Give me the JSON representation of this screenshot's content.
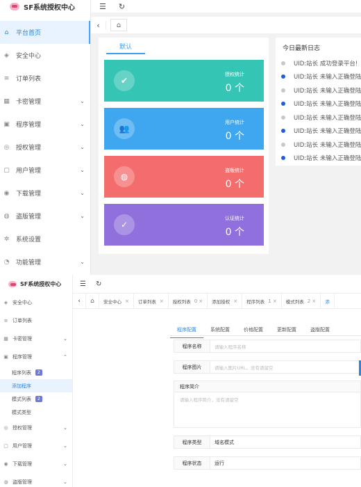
{
  "top": {
    "app_title": "SF系统授权中心",
    "menu": [
      {
        "label": "平台首页",
        "icon": "home-icon",
        "glyph": "⌂",
        "active": true,
        "chevron": false
      },
      {
        "label": "安全中心",
        "icon": "shield-icon",
        "glyph": "◈",
        "active": false,
        "chevron": false
      },
      {
        "label": "订单列表",
        "icon": "list-icon",
        "glyph": "≡",
        "active": false,
        "chevron": false
      },
      {
        "label": "卡密管理",
        "icon": "card-icon",
        "glyph": "▦",
        "active": false,
        "chevron": true
      },
      {
        "label": "程序管理",
        "icon": "app-icon",
        "glyph": "▣",
        "active": false,
        "chevron": true
      },
      {
        "label": "授权管理",
        "icon": "key-icon",
        "glyph": "◎",
        "active": false,
        "chevron": true
      },
      {
        "label": "用户管理",
        "icon": "user-icon",
        "glyph": "▢",
        "active": false,
        "chevron": true
      },
      {
        "label": "下载管理",
        "icon": "download-icon",
        "glyph": "◉",
        "active": false,
        "chevron": true
      },
      {
        "label": "盗版管理",
        "icon": "piracy-icon",
        "glyph": "◍",
        "active": false,
        "chevron": true
      },
      {
        "label": "系统设置",
        "icon": "gear-icon",
        "glyph": "✲",
        "active": false,
        "chevron": false
      },
      {
        "label": "功能管理",
        "icon": "function-icon",
        "glyph": "◔",
        "active": false,
        "chevron": true
      }
    ],
    "topbar_icons": {
      "menu_glyph": "☰",
      "refresh_glyph": "↻"
    },
    "tabbar": {
      "back_glyph": "‹",
      "home_glyph": "⌂"
    },
    "panel_tab": "默认",
    "stats": [
      {
        "label": "授权统计",
        "value": "0 个",
        "color": "#35c5b4",
        "icon": "shield-check-icon",
        "glyph": "✔"
      },
      {
        "label": "用户统计",
        "value": "0 个",
        "color": "#3ea7ef",
        "icon": "users-icon",
        "glyph": "👥"
      },
      {
        "label": "盗版统计",
        "value": "0 个",
        "color": "#f46d6d",
        "icon": "globe-icon",
        "glyph": "◍"
      },
      {
        "label": "认证统计",
        "value": "0 个",
        "color": "#9070dc",
        "icon": "check-circle-icon",
        "glyph": "✓"
      }
    ],
    "log_title": "今日最新日志",
    "logs": [
      {
        "text": "UID:站长 成功登录平台!",
        "dot": "#c8c8c8"
      },
      {
        "text": "UID:站长 未输入正确登陆",
        "dot": "#1e5fd8"
      },
      {
        "text": "UID:站长 未输入正确登陆",
        "dot": "#c8c8c8"
      },
      {
        "text": "UID:站长 未输入正确登陆",
        "dot": "#1e5fd8"
      },
      {
        "text": "UID:站长 未输入正确登陆",
        "dot": "#c8c8c8"
      },
      {
        "text": "UID:站长 未输入正确登陆",
        "dot": "#1e5fd8"
      },
      {
        "text": "UID:站长 未输入正确登陆",
        "dot": "#c8c8c8"
      },
      {
        "text": "UID:站长 未输入正确登陆",
        "dot": "#1e5fd8"
      }
    ]
  },
  "bottom": {
    "app_title": "SF系统授权中心",
    "menu_before": [
      {
        "label": "安全中心",
        "icon": "shield-icon",
        "glyph": "◈",
        "chevron": false
      },
      {
        "label": "订单列表",
        "icon": "list-icon",
        "glyph": "≡",
        "chevron": false
      },
      {
        "label": "卡密管理",
        "icon": "card-icon",
        "glyph": "▦",
        "chevron": true
      },
      {
        "label": "程序管理",
        "icon": "app-icon",
        "glyph": "▣",
        "chevron": true,
        "chevron_glyph": "⌃"
      }
    ],
    "submenu": [
      {
        "label": "程序列表",
        "badge": "2",
        "active": false
      },
      {
        "label": "添加程序",
        "badge": "",
        "active": true
      },
      {
        "label": "模式列表",
        "badge": "2",
        "active": false
      },
      {
        "label": "模式类型",
        "badge": "",
        "active": false
      }
    ],
    "menu_after": [
      {
        "label": "授权管理",
        "icon": "key-icon",
        "glyph": "◎",
        "chevron": true
      },
      {
        "label": "用户管理",
        "icon": "user-icon",
        "glyph": "▢",
        "chevron": true
      },
      {
        "label": "下载管理",
        "icon": "download-icon",
        "glyph": "◉",
        "chevron": true
      },
      {
        "label": "盗版管理",
        "icon": "piracy-icon",
        "glyph": "◍",
        "chevron": true
      }
    ],
    "tabs": [
      {
        "label": "安全中心",
        "close": "×",
        "current": false
      },
      {
        "label": "订单列表",
        "close": "×",
        "current": false
      },
      {
        "label": "授权列表",
        "close": "0 ×",
        "current": false
      },
      {
        "label": "添加授权",
        "close": "×",
        "current": false
      },
      {
        "label": "程序列表",
        "close": "1 ×",
        "current": false
      },
      {
        "label": "模式列表",
        "close": "2 ×",
        "current": false
      },
      {
        "label": "添",
        "close": "",
        "current": true
      }
    ],
    "form_tabs": [
      {
        "label": "程序配置",
        "active": true
      },
      {
        "label": "系统配置",
        "active": false
      },
      {
        "label": "价格配置",
        "active": false
      },
      {
        "label": "更新配置",
        "active": false
      },
      {
        "label": "盗版配置",
        "active": false
      }
    ],
    "fields": {
      "name_label": "程序名称",
      "name_placeholder": "请输入程序名称",
      "image_label": "程序图片",
      "image_placeholder": "请输入图片URL，没有请留空",
      "intro_label": "程序简介",
      "intro_placeholder": "请输入程序简介，没有请留空",
      "type_label": "程序类型",
      "type_value": "域名模式",
      "status_label": "程序状态",
      "status_value": "运行"
    }
  }
}
